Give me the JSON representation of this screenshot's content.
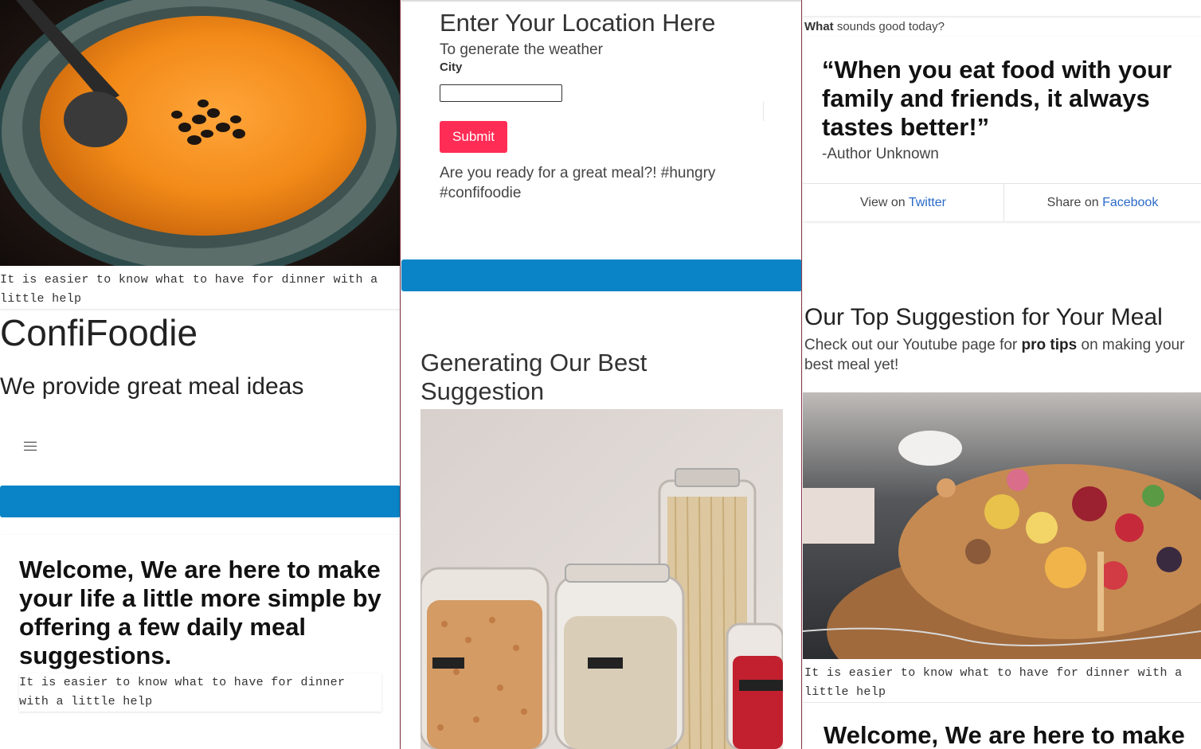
{
  "panel1": {
    "caption_top": "It is easier to know what to have for dinner with a little help",
    "brand": "ConfiFoodie",
    "tagline": "We provide great meal ideas",
    "welcome_heading": "Welcome, We are here to make your life a little more simple by offering a few daily meal suggestions.",
    "caption_bottom": "It is easier to know what to have for dinner with a little help"
  },
  "panel2": {
    "location_heading": "Enter Your Location Here",
    "location_sub": "To generate the weather",
    "city_label": "City",
    "city_value": "",
    "submit_label": "Submit",
    "ready_text": "Are you ready for a great meal?! #hungry #confifoodie",
    "generating_heading": "Generating Our Best Suggestion"
  },
  "panel3": {
    "prompt_bold": "What",
    "prompt_rest": " sounds good today?",
    "quote": "“When you eat food with your family and friends, it always tastes better!”",
    "quote_author": "-Author Unknown",
    "view_prefix": "View on ",
    "view_link": "Twitter",
    "share_prefix": "Share on ",
    "share_link": "Facebook",
    "top_heading": "Our Top Suggestion for Your Meal",
    "youtube_text_1": "Check out our Youtube page for ",
    "youtube_bold": "pro tips",
    "youtube_text_2": " on making your best meal yet!",
    "caption": "It is easier to know what to have for dinner with a little help",
    "welcome_partial": "Welcome, We are here to make"
  },
  "colors": {
    "blue_bar": "#0a84c6",
    "submit": "#ff2d55",
    "link": "#2a6ac8"
  },
  "icons": {
    "menu": "hamburger-menu-icon"
  }
}
